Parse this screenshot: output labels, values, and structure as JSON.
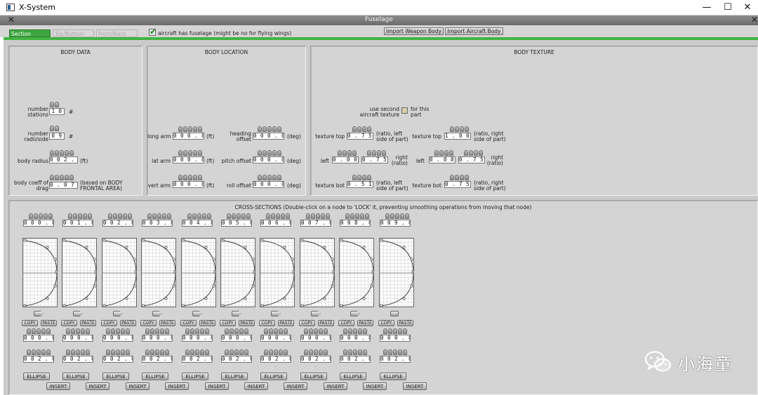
{
  "window": {
    "title": "X-System",
    "minimize": "—",
    "maximize": "☐",
    "close": "✕"
  },
  "dialog": {
    "title": "Fuselage",
    "close": "✕"
  },
  "tabs": [
    {
      "label": "Section",
      "active": true
    },
    {
      "label": "Top/Bottom",
      "active": false
    },
    {
      "label": "Front/Back",
      "active": false
    }
  ],
  "has_fuselage": {
    "label": "aircraft has fuselage (might be no for flying wings)",
    "checked": true
  },
  "buttons": {
    "import_weapon": "Import Weapon Body",
    "import_aircraft": "Import Aircraft Body"
  },
  "body_data": {
    "title": "BODY DATA",
    "number_stations": {
      "label": "number stations",
      "value": "10",
      "unit": "#"
    },
    "number_radii": {
      "label": "number radii/side",
      "value": "09",
      "unit": "#"
    },
    "body_radius": {
      "label": "body radius",
      "value": "002.00",
      "unit": "(ft)"
    },
    "body_coeff": {
      "label": "body coeff of drag",
      "value": "0.075",
      "unit": "(based on BODY FRONTAL AREA)"
    }
  },
  "body_location": {
    "title": "BODY LOCATION",
    "long_arm": {
      "label": "long arm",
      "value": "000.00",
      "unit": "(ft)"
    },
    "lat_arm": {
      "label": "lat arm",
      "value": "000.00",
      "unit": "(ft)"
    },
    "vert_arm": {
      "label": "vert arm",
      "value": "000.00",
      "unit": "(ft)"
    },
    "heading_offset": {
      "label": "heading offset",
      "value": "000.00",
      "unit": "(deg)"
    },
    "pitch_offset": {
      "label": "pitch offset",
      "value": "000.00",
      "unit": "(deg)"
    },
    "roll_offset": {
      "label": "roll offset",
      "value": "000.00",
      "unit": "(deg)"
    }
  },
  "body_texture": {
    "title": "BODY TEXTURE",
    "use_second": {
      "label": "use second aircraft texture",
      "label2": "for this part",
      "checked": false
    },
    "left_side": {
      "top": {
        "label": "texture top",
        "value": "0.754",
        "note": "(ratio, left side of part)"
      },
      "left": {
        "label": "left",
        "value": "0.000"
      },
      "right": {
        "value": "0.754",
        "note": "right (ratio)"
      },
      "bot": {
        "label": "texture bot",
        "value": "0.510",
        "note": "(ratio, left side of part)"
      }
    },
    "right_side": {
      "top": {
        "label": "texture top",
        "value": "1.000",
        "note": "(ratio, right side of part)"
      },
      "left": {
        "label": "left",
        "value": "0.000"
      },
      "right": {
        "value": "0.754",
        "note": "right (ratio)"
      },
      "bot": {
        "label": "texture bot",
        "value": "0.756",
        "note": "(ratio, right side of part)"
      }
    }
  },
  "cross_sections": {
    "title": "CROSS-SECTIONS (Double-click on a node to 'LOCK' it, preventing smoothing operations from moving that node)",
    "copy_label": "COPY",
    "paste_label": "PASTE",
    "ellipse_label": "ELLIPSE",
    "insert_label": "INSERT",
    "stations": [
      {
        "pos": "000.00",
        "a": "000.00",
        "b": "002.00"
      },
      {
        "pos": "001.00",
        "a": "000.00",
        "b": "002.00"
      },
      {
        "pos": "002.00",
        "a": "000.00",
        "b": "002.00"
      },
      {
        "pos": "003.00",
        "a": "000.00",
        "b": "002.00"
      },
      {
        "pos": "004.00",
        "a": "000.00",
        "b": "002.00"
      },
      {
        "pos": "005.00",
        "a": "000.00",
        "b": "002.00"
      },
      {
        "pos": "006.00",
        "a": "000.00",
        "b": "002.00"
      },
      {
        "pos": "007.00",
        "a": "000.00",
        "b": "002.00"
      },
      {
        "pos": "008.00",
        "a": "000.00",
        "b": "002.00"
      },
      {
        "pos": "009.00",
        "a": "000.00",
        "b": "002.00"
      }
    ]
  },
  "watermark": {
    "text": "小海童"
  }
}
